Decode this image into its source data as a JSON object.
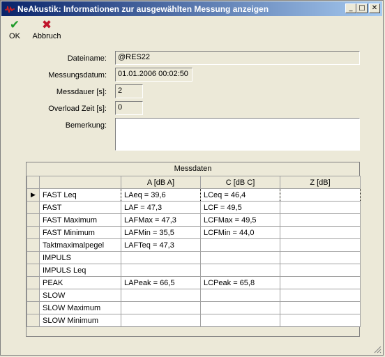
{
  "window": {
    "title": "NeAkustik: Informationen zur ausgewählten Messung anzeigen",
    "minimize_glyph": "_",
    "maximize_glyph": "□",
    "close_glyph": "✕"
  },
  "toolbar": {
    "ok_label": "OK",
    "cancel_label": "Abbruch",
    "ok_glyph": "✔",
    "cancel_glyph": "✖",
    "ok_icon": "green-check-icon",
    "cancel_icon": "red-double-left-arrow-icon"
  },
  "form": {
    "filename_label": "Dateiname:",
    "filename_value": "@RES22",
    "date_label": "Messungsdatum:",
    "date_value": "01.01.2006 00:02:50",
    "duration_label": "Messdauer [s]:",
    "duration_value": "2",
    "overload_label": "Overload Zeit [s]:",
    "overload_value": "0",
    "remark_label": "Bemerkung:",
    "remark_value": ""
  },
  "grid": {
    "title": "Messdaten",
    "columns": [
      "A [dB A]",
      "C [dB C]",
      "Z [dB]"
    ],
    "selected_indicator": "▶",
    "rows": [
      {
        "name": "FAST Leq",
        "a": "LAeq = 39,6",
        "c": "LCeq = 46,4",
        "z": ""
      },
      {
        "name": "FAST",
        "a": "LAF = 47,3",
        "c": "LCF = 49,5",
        "z": ""
      },
      {
        "name": "FAST Maximum",
        "a": "LAFMax = 47,3",
        "c": "LCFMax = 49,5",
        "z": ""
      },
      {
        "name": "FAST Minimum",
        "a": "LAFMin = 35,5",
        "c": "LCFMin = 44,0",
        "z": ""
      },
      {
        "name": "Taktmaximalpegel",
        "a": "LAFTeq = 47,3",
        "c": "",
        "z": ""
      },
      {
        "name": "IMPULS",
        "a": "",
        "c": "",
        "z": ""
      },
      {
        "name": "IMPULS Leq",
        "a": "",
        "c": "",
        "z": ""
      },
      {
        "name": "PEAK",
        "a": "LAPeak = 66,5",
        "c": "LCPeak = 65,8",
        "z": ""
      },
      {
        "name": "SLOW",
        "a": "",
        "c": "",
        "z": ""
      },
      {
        "name": "SLOW Maximum",
        "a": "",
        "c": "",
        "z": ""
      },
      {
        "name": "SLOW Minimum",
        "a": "",
        "c": "",
        "z": ""
      }
    ]
  },
  "colors": {
    "titlebar_start": "#0a246a",
    "titlebar_end": "#a6caf0",
    "ok_green": "#1f9b2a",
    "cancel_red": "#c0142a"
  }
}
